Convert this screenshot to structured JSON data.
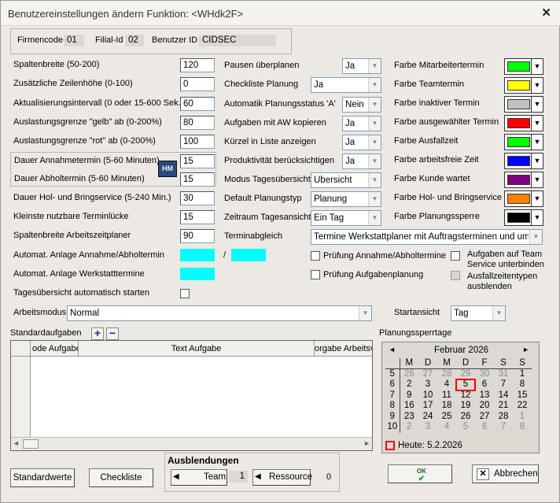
{
  "window": {
    "title": "Benutzereinstellungen ändern  Funktion: <WHdk2F>"
  },
  "colors": {
    "accent": "#00ffff",
    "today_marker": "#e00000"
  },
  "header": {
    "firmencode_label": "Firmencode",
    "firmencode": "01",
    "filial_label": "Filial-Id",
    "filial": "02",
    "benutzer_label": "Benutzer ID",
    "benutzer": "CIDSEC"
  },
  "fields": {
    "spaltenbreite": {
      "label": "Spaltenbreite (50-200)",
      "value": "120"
    },
    "zeilenhoehe": {
      "label": "Zusätzliche Zeilenhöhe (0-100)",
      "value": "0"
    },
    "aktualisierung": {
      "label": "Aktualisierungsintervall (0 oder 15-600 Sek.)",
      "value": "60"
    },
    "gelb": {
      "label": "Auslastungsgrenze \"gelb\" ab (0-200%)",
      "value": "80"
    },
    "rot": {
      "label": "Auslastungsgrenze \"rot\" ab (0-200%)",
      "value": "100"
    },
    "annahme": {
      "label": "Dauer Annahmetermin (5-60 Minuten)",
      "value": "15"
    },
    "abhol": {
      "label": "Dauer Abholtermin (5-60 Minuten)",
      "value": "15"
    },
    "holbring": {
      "label": "Dauer Hol- und Bringservice (5-240 Min.)",
      "value": "30"
    },
    "luecke": {
      "label": "Kleinste nutzbare Terminlücke",
      "value": "15"
    },
    "arbeitszeit": {
      "label": "Spaltenbreite Arbeitszeitplaner",
      "value": "90"
    },
    "anlage_annahme": {
      "label": "Automat. Anlage Annahme/Abholtermin"
    },
    "anlage_werkstatt": {
      "label": "Automat. Anlage Werkstatttermine"
    },
    "auto_start": {
      "label": "Tagesübersicht automatisch starten"
    },
    "slash": "/",
    "hm_icon": "HM"
  },
  "mid": {
    "pausen": {
      "label": "Pausen überplanen",
      "value": "Ja"
    },
    "checkliste": {
      "label": "Checkliste Planung",
      "value": "Ja"
    },
    "status": {
      "label": "Automatik Planungsstatus 'A'",
      "value": "Nein"
    },
    "aw": {
      "label": "Aufgaben mit AW kopieren",
      "value": "Ja"
    },
    "kuerzel": {
      "label": "Kürzel in Liste anzeigen",
      "value": "Ja"
    },
    "produktiv": {
      "label": "Produktivität berücksichtigen",
      "value": "Ja"
    },
    "modus": {
      "label": "Modus Tagesübersicht",
      "value": "Übersicht"
    },
    "typ": {
      "label": "Default Planungstyp",
      "value": "Planung"
    },
    "zeitraum": {
      "label": "Zeitraum Tagesansicht",
      "value": "Ein Tag"
    },
    "abgleich": {
      "label": "Terminabgleich",
      "value": "Termine Werkstattplaner mit Auftragsterminen und umgekehrt"
    },
    "pruef1": "Prüfung Annahme/Abholtermine",
    "pruef2": "Prüfung Aufgabenplanung",
    "team_service": "Aufgaben auf Team Service unterbinden",
    "ausfall": "Ausfallzeitentypen ausblenden"
  },
  "farben": [
    {
      "label": "Farbe Mitarbeitertermin",
      "color": "#00ff00"
    },
    {
      "label": "Farbe Teamtermin",
      "color": "#ffff00"
    },
    {
      "label": "Farbe inaktiver Termin",
      "color": "#c0c0c0"
    },
    {
      "label": "Farbe ausgewählter Termin",
      "color": "#ff0000"
    },
    {
      "label": "Farbe Ausfallzeit",
      "color": "#00ff00"
    },
    {
      "label": "Farbe arbeitsfreie Zeit",
      "color": "#0000ff"
    },
    {
      "label": "Farbe Kunde wartet",
      "color": "#800080"
    },
    {
      "label": "Farbe Hol- und Bringservice",
      "color": "#ff8000"
    },
    {
      "label": "Farbe Planungssperre",
      "color": "#000000"
    }
  ],
  "arbeitsmodus": {
    "label": "Arbeitsmodus",
    "value": "Normal"
  },
  "startansicht": {
    "label": "Startansicht",
    "value": "Tag"
  },
  "standardaufgaben": {
    "label": "Standardaufgaben",
    "add": "+",
    "remove": "−",
    "columns": [
      "ode Aufgabe",
      "Text Aufgabe",
      "orgabe Arbeitsv"
    ]
  },
  "planungssperre": {
    "label": "Planungssperrtage"
  },
  "calendar": {
    "month": "Februar 2026",
    "prev": "◄",
    "next": "►",
    "days": [
      "M",
      "D",
      "M",
      "D",
      "F",
      "S",
      "S"
    ],
    "weeks": [
      {
        "wk": "5",
        "d": [
          "26",
          "27",
          "28",
          "29",
          "30",
          "31",
          "1"
        ]
      },
      {
        "wk": "6",
        "d": [
          "2",
          "3",
          "4",
          "5",
          "6",
          "7",
          "8"
        ]
      },
      {
        "wk": "7",
        "d": [
          "9",
          "10",
          "11",
          "12",
          "13",
          "14",
          "15"
        ]
      },
      {
        "wk": "8",
        "d": [
          "16",
          "17",
          "18",
          "19",
          "20",
          "21",
          "22"
        ]
      },
      {
        "wk": "9",
        "d": [
          "23",
          "24",
          "25",
          "26",
          "27",
          "28",
          "1"
        ]
      },
      {
        "wk": "10",
        "d": [
          "2",
          "3",
          "4",
          "5",
          "6",
          "7",
          "8"
        ]
      }
    ],
    "today": "Heute: 5.2.2026"
  },
  "ausblendungen": {
    "label": "Ausblendungen",
    "team": "Team",
    "team_count": "1",
    "ressource": "Ressource",
    "ressource_count": "0"
  },
  "buttons": {
    "standardwerte": "Standardwerte",
    "checkliste": "Checkliste",
    "ok": "OK",
    "abbrechen": "Abbrechen"
  }
}
